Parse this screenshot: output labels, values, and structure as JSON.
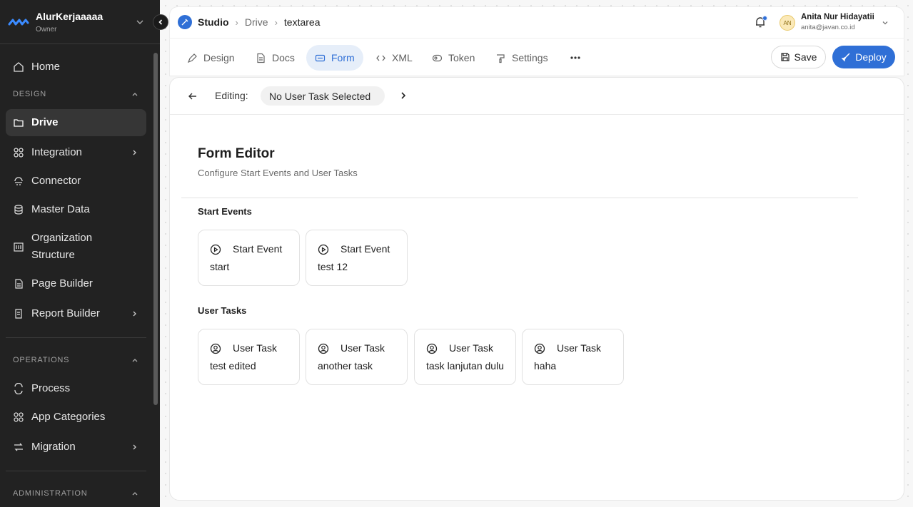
{
  "workspace": {
    "name": "AlurKerjaaaaa",
    "role": "Owner"
  },
  "sidebar": {
    "home": "Home",
    "design_section": "DESIGN",
    "design_items": [
      {
        "label": "Drive",
        "icon": "folder-icon",
        "active": true
      },
      {
        "label": "Integration",
        "icon": "grid-icon",
        "has_submenu": true
      },
      {
        "label": "Connector",
        "icon": "plug-icon"
      },
      {
        "label": "Master Data",
        "icon": "database-icon"
      },
      {
        "label": "Organization Structure",
        "icon": "org-icon"
      },
      {
        "label": "Page Builder",
        "icon": "page-icon"
      },
      {
        "label": "Report Builder",
        "icon": "report-icon",
        "has_submenu": true
      }
    ],
    "operations_section": "OPERATIONS",
    "operations_items": [
      {
        "label": "Process",
        "icon": "process-icon"
      },
      {
        "label": "App Categories",
        "icon": "grid-icon"
      },
      {
        "label": "Migration",
        "icon": "migration-icon",
        "has_submenu": true
      }
    ],
    "administration_section": "ADMINISTRATION"
  },
  "breadcrumb": {
    "root": "Studio",
    "parent": "Drive",
    "current": "textarea"
  },
  "user": {
    "initials": "AN",
    "name": "Anita Nur Hidayatii",
    "email": "anita@javan.co.id"
  },
  "tabs": [
    {
      "label": "Design",
      "icon": "pen-icon"
    },
    {
      "label": "Docs",
      "icon": "document-icon"
    },
    {
      "label": "Form",
      "icon": "form-icon",
      "active": true
    },
    {
      "label": "XML",
      "icon": "code-icon"
    },
    {
      "label": "Token",
      "icon": "token-icon"
    },
    {
      "label": "Settings",
      "icon": "brush-icon"
    }
  ],
  "actions": {
    "save": "Save",
    "deploy": "Deploy"
  },
  "editor": {
    "editing_label": "Editing:",
    "selected_task": "No User Task Selected",
    "title": "Form Editor",
    "subtitle": "Configure Start Events and User Tasks",
    "start_events_title": "Start Events",
    "start_events": [
      {
        "type": "Start Event",
        "name": "start"
      },
      {
        "type": "Start Event",
        "name": "test 12"
      }
    ],
    "user_tasks_title": "User Tasks",
    "user_tasks": [
      {
        "type": "User Task",
        "name": "test edited"
      },
      {
        "type": "User Task",
        "name": "another task"
      },
      {
        "type": "User Task",
        "name": "task lanjutan dulu"
      },
      {
        "type": "User Task",
        "name": "haha"
      }
    ]
  },
  "colors": {
    "accent": "#2f6fd6",
    "sidebar_bg": "#222222",
    "active_tab_bg": "#e6eef9"
  }
}
